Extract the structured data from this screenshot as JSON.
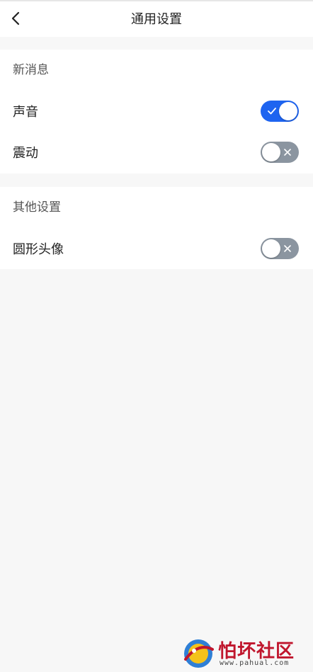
{
  "header": {
    "title": "通用设置",
    "back_icon": "chevron-left-icon"
  },
  "sections": [
    {
      "title": "新消息",
      "rows": [
        {
          "label": "声音",
          "enabled": true
        },
        {
          "label": "震动",
          "enabled": false
        }
      ]
    },
    {
      "title": "其他设置",
      "rows": [
        {
          "label": "圆形头像",
          "enabled": false
        }
      ]
    }
  ],
  "colors": {
    "accent": "#1e64f0",
    "switch_off": "#8b95a0",
    "page_background": "#f7f7f7"
  },
  "watermark": {
    "text": "怕坏社区",
    "url": "www.pahual.com"
  }
}
